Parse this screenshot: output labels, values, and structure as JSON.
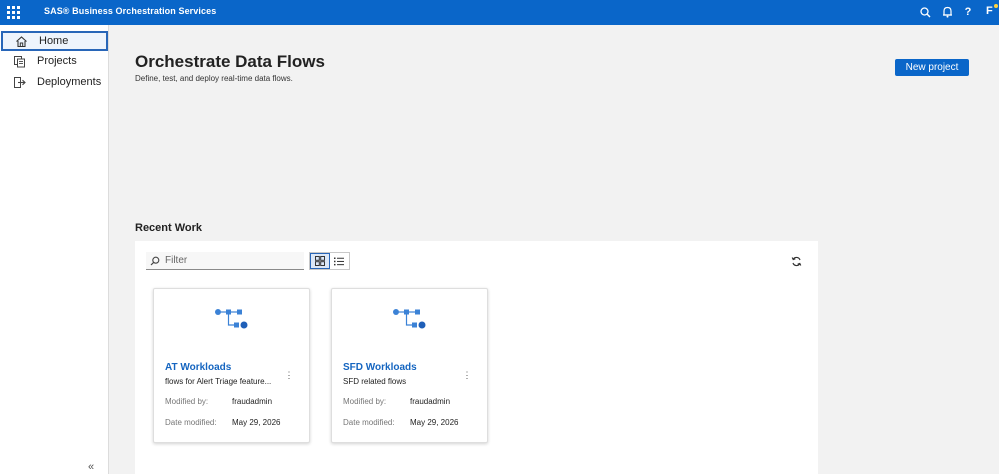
{
  "app": {
    "title": "SAS® Business Orchestration Services",
    "user_initial": "F"
  },
  "topbar": {
    "icons": [
      "apps-grid-icon",
      "search-icon",
      "bell-icon",
      "help-icon"
    ],
    "help_glyph": "?"
  },
  "sidebar": {
    "items": [
      {
        "label": "Home",
        "icon": "home-icon",
        "active": true
      },
      {
        "label": "Projects",
        "icon": "projects-icon",
        "active": false
      },
      {
        "label": "Deployments",
        "icon": "deployments-icon",
        "active": false
      }
    ],
    "collapse_glyph": "«"
  },
  "main": {
    "title": "Orchestrate Data Flows",
    "subtitle": "Define, test, and deploy real-time data flows.",
    "new_project_label": "New project",
    "recent_title": "Recent Work",
    "filter_placeholder": "Filter",
    "view_modes": [
      "grid",
      "list"
    ],
    "active_view": "grid"
  },
  "cards": [
    {
      "name": "AT Workloads",
      "description": "flows for Alert Triage feature...",
      "modified_by_label": "Modified by:",
      "modified_by": "fraudadmin",
      "date_label": "Date modified:",
      "date": "May 29, 2026"
    },
    {
      "name": "SFD Workloads",
      "description": "SFD related flows",
      "modified_by_label": "Modified by:",
      "modified_by": "fraudadmin",
      "date_label": "Date modified:",
      "date": "May 29, 2026"
    }
  ],
  "colors": {
    "brand": "#0a66c9",
    "link": "#1565c0",
    "flow_icon": "#3b82d6"
  }
}
